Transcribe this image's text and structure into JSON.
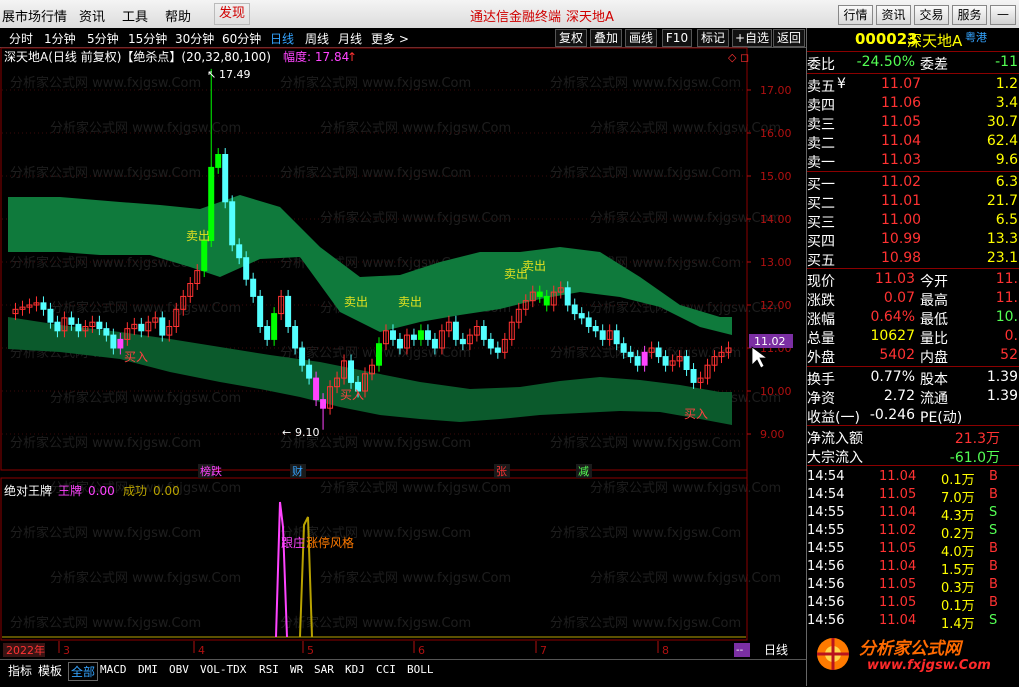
{
  "menubar": {
    "items": [
      "展市场行情",
      "资讯",
      "工具",
      "帮助",
      "发现"
    ],
    "center_title": "通达信金融终端",
    "center_stock": "深天地A",
    "right_buttons": [
      "行情",
      "资讯",
      "交易",
      "服务"
    ]
  },
  "toolbar": {
    "periods": [
      "分时",
      "1分钟",
      "5分钟",
      "15分钟",
      "30分钟",
      "60分钟",
      "日线",
      "周线",
      "月线",
      "更多 >"
    ],
    "active": "日线",
    "right_buttons": [
      "复权",
      "叠加",
      "画线",
      "F10",
      "标记",
      "+自选",
      "返回"
    ]
  },
  "chart": {
    "title": "深天地A(日线 前复权)【绝杀点】(20,32,80,100)",
    "range_label": "幅度: 17.84",
    "range_arrow": "↑",
    "watermark": "分析家公式网  www.fxjgsw.Com",
    "price_axis": [
      "17.00",
      "16.00",
      "15.00",
      "14.00",
      "13.00",
      "12.00",
      "11.00",
      "10.00",
      "9.00"
    ],
    "current_price_tag": "11.02",
    "high_label": "17.49",
    "low_label": "9.10",
    "signal_labels": {
      "buy": "买入",
      "sell": "卖出"
    },
    "events": [
      "榜跌",
      "财",
      "张",
      "减"
    ],
    "indicator_title": "绝对王牌",
    "indicator_fields": [
      {
        "name": "王牌",
        "value": "0.00"
      },
      {
        "name": "成功",
        "value": "0.00"
      }
    ],
    "indicator_texts": [
      "跟庄",
      "涨停风格"
    ],
    "date_labels": [
      "2022年",
      "3",
      "4",
      "5",
      "6",
      "7",
      "8"
    ],
    "period_tag": "日线"
  },
  "quote": {
    "code": "000023",
    "name": "深天地A",
    "market": "粤港",
    "webi": {
      "label": "委比",
      "value": "-24.50%",
      "label2": "委差",
      "value2": "-11"
    },
    "asks": [
      {
        "label": "卖五",
        "flag": "¥",
        "price": "11.07",
        "vol": "1.2"
      },
      {
        "label": "卖四",
        "price": "11.06",
        "vol": "3.4"
      },
      {
        "label": "卖三",
        "price": "11.05",
        "vol": "30.7"
      },
      {
        "label": "卖二",
        "price": "11.04",
        "vol": "62.4"
      },
      {
        "label": "卖一",
        "price": "11.03",
        "vol": "9.6"
      }
    ],
    "bids": [
      {
        "label": "买一",
        "price": "11.02",
        "vol": "6.3"
      },
      {
        "label": "买二",
        "price": "11.01",
        "vol": "21.7"
      },
      {
        "label": "买三",
        "price": "11.00",
        "vol": "6.5"
      },
      {
        "label": "买四",
        "price": "10.99",
        "vol": "13.3"
      },
      {
        "label": "买五",
        "price": "10.98",
        "vol": "23.1"
      }
    ],
    "stats": [
      {
        "l1": "现价",
        "v1": "11.03",
        "l2": "今开",
        "v2": "11."
      },
      {
        "l1": "涨跌",
        "v1": "0.07",
        "l2": "最高",
        "v2": "11."
      },
      {
        "l1": "涨幅",
        "v1": "0.64%",
        "l2": "最低",
        "v2": "10."
      },
      {
        "l1": "总量",
        "v1": "10627",
        "l2": "量比",
        "v2": "0."
      },
      {
        "l1": "外盘",
        "v1": "5402",
        "l2": "内盘",
        "v2": "52"
      }
    ],
    "stats2": [
      {
        "l1": "换手",
        "v1": "0.77%",
        "l2": "股本",
        "v2": "1.39"
      },
      {
        "l1": "净资",
        "v1": "2.72",
        "l2": "流通",
        "v2": "1.39"
      },
      {
        "l1": "收益(一)",
        "v1": "-0.246",
        "l2": "PE(动)",
        "v2": ""
      }
    ],
    "flows": [
      {
        "label": "净流入额",
        "value": "21.3万"
      },
      {
        "label": "大宗流入",
        "value": "-61.0万"
      }
    ],
    "ticks": [
      {
        "time": "14:54",
        "price": "11.04",
        "vol": "0.1万",
        "side": "B"
      },
      {
        "time": "14:54",
        "price": "11.05",
        "vol": "7.0万",
        "side": "B"
      },
      {
        "time": "14:55",
        "price": "11.04",
        "vol": "4.3万",
        "side": "S"
      },
      {
        "time": "14:55",
        "price": "11.02",
        "vol": "0.2万",
        "side": "S"
      },
      {
        "time": "14:55",
        "price": "11.05",
        "vol": "4.0万",
        "side": "B"
      },
      {
        "time": "14:56",
        "price": "11.04",
        "vol": "1.5万",
        "side": "B"
      },
      {
        "time": "14:56",
        "price": "11.05",
        "vol": "0.3万",
        "side": "B"
      },
      {
        "time": "14:56",
        "price": "11.05",
        "vol": "0.1万",
        "side": "B"
      },
      {
        "time": "14:56",
        "price": "11.04",
        "vol": "1.4万",
        "side": "S"
      }
    ],
    "logo_text": "分析家公式网",
    "logo_url": "www.fxjgsw.Com"
  },
  "bottombar": {
    "tabs": [
      "指标",
      "模板",
      "全部"
    ],
    "indicators": [
      "MACD",
      "DMI",
      "OBV",
      "VOL-TDX",
      "RSI",
      "WR",
      "SAR",
      "KDJ",
      "CCI",
      "BOLL"
    ]
  },
  "colors": {
    "up": "#ff3232",
    "down": "#54ffff",
    "sell_signal": "#00ff00",
    "buy_signal": "#ff44ff",
    "band": "#0f7a3c",
    "axis": "#b01010"
  }
}
